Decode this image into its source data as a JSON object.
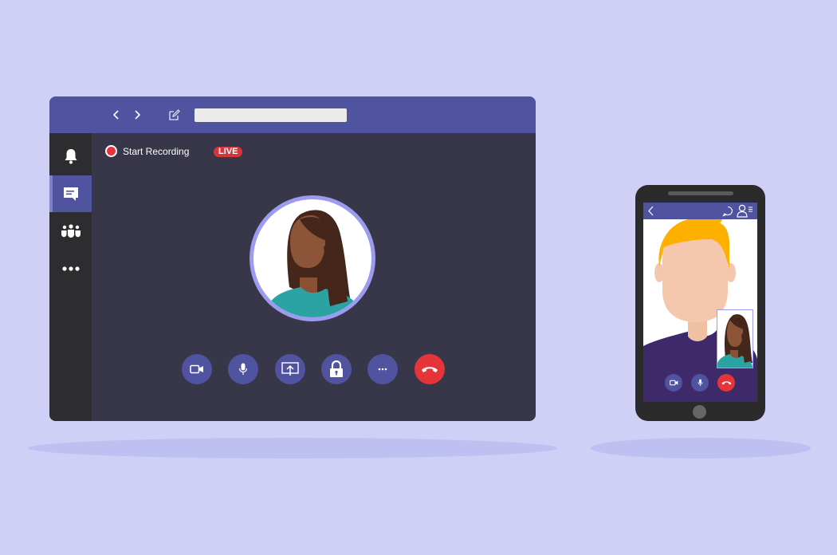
{
  "desktop_app": {
    "titlebar": {
      "back_icon": "chevron-left",
      "forward_icon": "chevron-right",
      "edit_icon": "compose",
      "search_value": "",
      "search_placeholder": ""
    },
    "sidebar": {
      "items": [
        {
          "name": "notifications",
          "icon": "bell",
          "active": false
        },
        {
          "name": "chat",
          "icon": "chat-bubble",
          "active": true
        },
        {
          "name": "teams",
          "icon": "people-group",
          "active": false
        },
        {
          "name": "more",
          "icon": "ellipsis",
          "active": false
        }
      ]
    },
    "call": {
      "record_label": "Start Recording",
      "live_badge": "LIVE",
      "controls": [
        {
          "name": "video",
          "icon": "video-camera"
        },
        {
          "name": "microphone",
          "icon": "microphone"
        },
        {
          "name": "share-screen",
          "icon": "share-screen"
        },
        {
          "name": "lock",
          "icon": "padlock"
        },
        {
          "name": "more",
          "icon": "ellipsis"
        },
        {
          "name": "hang-up",
          "icon": "phone-hangup"
        }
      ]
    }
  },
  "mobile_app": {
    "header": {
      "back_icon": "chevron-left",
      "chat_icon": "chat-bubble",
      "participants_icon": "person-list"
    },
    "controls": [
      {
        "name": "video",
        "icon": "video-camera"
      },
      {
        "name": "microphone",
        "icon": "microphone"
      },
      {
        "name": "hang-up",
        "icon": "phone-hangup"
      }
    ]
  },
  "colors": {
    "background": "#d0cff6",
    "brand": "#5053a0",
    "danger": "#e53538",
    "window_body": "#383749",
    "sidebar": "#2d2d30"
  }
}
